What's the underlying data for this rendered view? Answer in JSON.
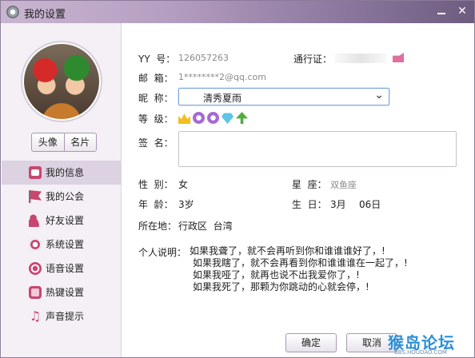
{
  "window": {
    "title": "我的设置"
  },
  "sidebar": {
    "photo_btn": "头像",
    "card_btn": "名片",
    "items": [
      {
        "label": "我的信息",
        "icon": "profile-card-icon"
      },
      {
        "label": "我的公会",
        "icon": "flag-icon"
      },
      {
        "label": "好友设置",
        "icon": "friend-settings-icon"
      },
      {
        "label": "系统设置",
        "icon": "gear-icon"
      },
      {
        "label": "语音设置",
        "icon": "voice-icon"
      },
      {
        "label": "热键设置",
        "icon": "hotkey-icon"
      },
      {
        "label": "声音提示",
        "icon": "music-note-icon"
      }
    ]
  },
  "profile": {
    "yy_label": "YY  号：",
    "yy_value": "126057263",
    "passport_label": "通行证：",
    "email_label": "邮  箱：",
    "email_value": "1********2@qq.com",
    "nick_label": "昵  称：",
    "nick_value": "清秀夏雨",
    "level_label": "等  级：",
    "sign_label": "签  名：",
    "gender_label": "性  别：",
    "gender_value": "女",
    "star_label": "星  座：",
    "star_value": "双鱼座",
    "age_label": "年  龄：",
    "age_value": "3岁",
    "birth_label": "生  日：",
    "birth_month": "3月",
    "birth_day": "06日",
    "location_label": "所在地：",
    "location_value": "行政区  台湾",
    "desc_label": "个人说明：",
    "desc_lines": [
      "如果我聋了，就不会再听到你和谁谁谁好了，!",
      "如果我瞎了，就不会再看到你和谁谁谁在一起了，!",
      "如果我哑了，就再也说不出我爱你了，!",
      "如果我死了，那颗为你跳动的心就会停，!"
    ]
  },
  "buttons": {
    "ok": "确定",
    "cancel": "取消"
  },
  "watermark": {
    "main": "猴岛论坛",
    "sub": "BBS.HOUDAO.COM"
  }
}
